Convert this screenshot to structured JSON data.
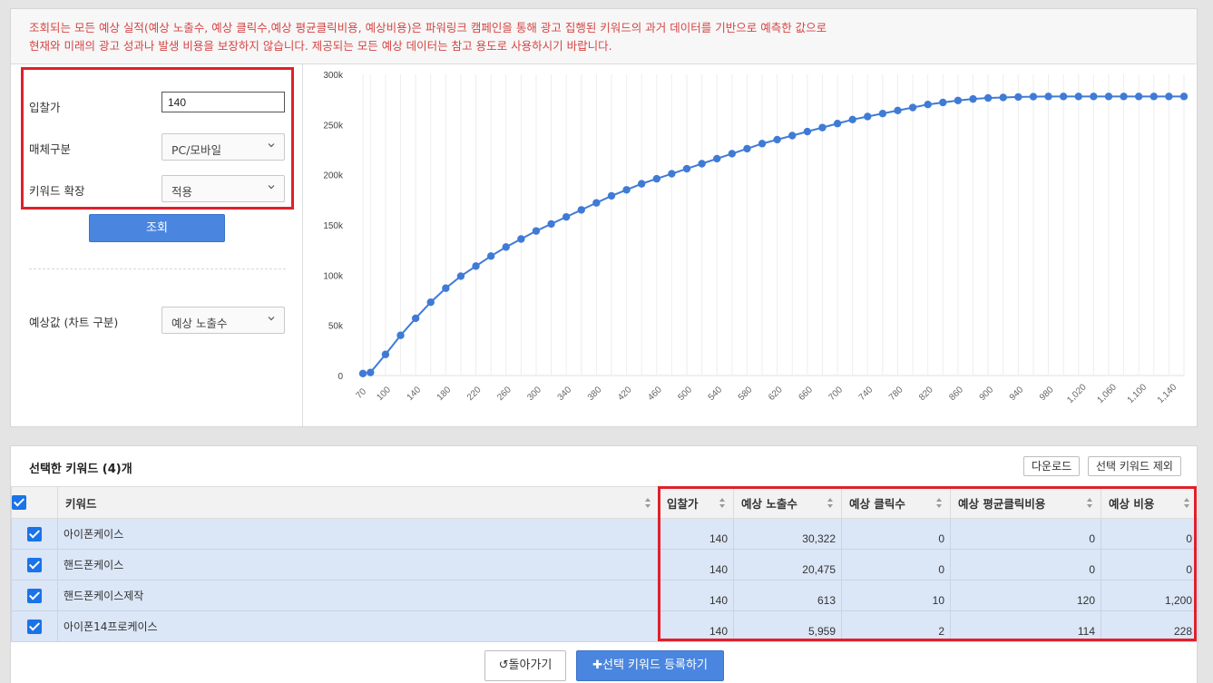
{
  "notice": {
    "line1": "조회되는 모든 예상 실적(예상 노출수, 예상 클릭수,예상 평균클릭비용, 예상비용)은 파워링크 캠페인을 통해 광고 집행된 키워드의 과거 데이터를 기반으로 예측한 값으로",
    "line2": "현재와 미래의 광고 성과나 발생 비용을 보장하지 않습니다. 제공되는 모든 예상 데이터는 참고 용도로 사용하시기 바랍니다."
  },
  "controls": {
    "bid_label": "입찰가",
    "bid_value": "140",
    "media_label": "매체구분",
    "media_value": "PC/모바일",
    "expand_label": "키워드 확장",
    "expand_value": "적용",
    "search_button": "조회",
    "chart_select_label": "예상값 (차트 구분)",
    "chart_select_value": "예상 노출수"
  },
  "colors": {
    "accent": "#4a86e0",
    "highlight_border": "#e0202b",
    "row_selected": "#dbe6f7",
    "notice_text": "#d64545"
  },
  "chart_data": {
    "type": "line",
    "ylim": [
      0,
      300000
    ],
    "y_ticks": [
      "0",
      "50k",
      "100k",
      "150k",
      "200k",
      "250k",
      "300k"
    ],
    "y_tick_values": [
      0,
      50000,
      100000,
      150000,
      200000,
      250000,
      300000
    ],
    "x_tick_labels": [
      "70",
      "100",
      "140",
      "180",
      "220",
      "260",
      "300",
      "340",
      "380",
      "420",
      "460",
      "500",
      "540",
      "580",
      "620",
      "660",
      "700",
      "740",
      "780",
      "820",
      "860",
      "900",
      "940",
      "980",
      "1,020",
      "1,060",
      "1,100",
      "1,140"
    ],
    "x": [
      70,
      80,
      100,
      120,
      140,
      160,
      180,
      200,
      220,
      240,
      260,
      280,
      300,
      320,
      340,
      360,
      380,
      400,
      420,
      440,
      460,
      480,
      500,
      520,
      540,
      560,
      580,
      600,
      620,
      640,
      660,
      680,
      700,
      720,
      740,
      760,
      780,
      800,
      820,
      840,
      860,
      880,
      900,
      920,
      940,
      960,
      980,
      1000,
      1020,
      1040,
      1060,
      1080,
      1100,
      1120,
      1140,
      1160
    ],
    "series": [
      {
        "values": [
          2000,
          3000,
          21000,
          40000,
          57000,
          73000,
          87000,
          99000,
          109000,
          119000,
          128000,
          136000,
          144000,
          151000,
          158000,
          165000,
          172000,
          179000,
          185000,
          191000,
          196000,
          201000,
          206000,
          211000,
          216000,
          221000,
          226000,
          231000,
          235000,
          239000,
          243000,
          247000,
          251000,
          255000,
          258000,
          261000,
          264000,
          267000,
          270000,
          272000,
          274000,
          275500,
          276500,
          277000,
          277500,
          277800,
          278000,
          278000,
          278000,
          278000,
          278000,
          278000,
          278000,
          278000,
          278000,
          278000
        ]
      }
    ],
    "grid": true
  },
  "keywords": {
    "title": "선택한 키워드 (4)개",
    "download_button": "다운로드",
    "exclude_button": "선택 키워드 제외",
    "columns": [
      "키워드",
      "입찰가",
      "예상 노출수",
      "예상 클릭수",
      "예상 평균클릭비용",
      "예상 비용"
    ],
    "rows": [
      {
        "keyword": "아이폰케이스",
        "bid": "140",
        "impressions": "30,322",
        "clicks": "0",
        "cpc": "0",
        "cost": "0"
      },
      {
        "keyword": "핸드폰케이스",
        "bid": "140",
        "impressions": "20,475",
        "clicks": "0",
        "cpc": "0",
        "cost": "0"
      },
      {
        "keyword": "핸드폰케이스제작",
        "bid": "140",
        "impressions": "613",
        "clicks": "10",
        "cpc": "120",
        "cost": "1,200"
      },
      {
        "keyword": "아이폰14프로케이스",
        "bid": "140",
        "impressions": "5,959",
        "clicks": "2",
        "cpc": "114",
        "cost": "228"
      }
    ]
  },
  "footer": {
    "back_button": "돌아가기",
    "register_button": "선택 키워드 등록하기"
  }
}
